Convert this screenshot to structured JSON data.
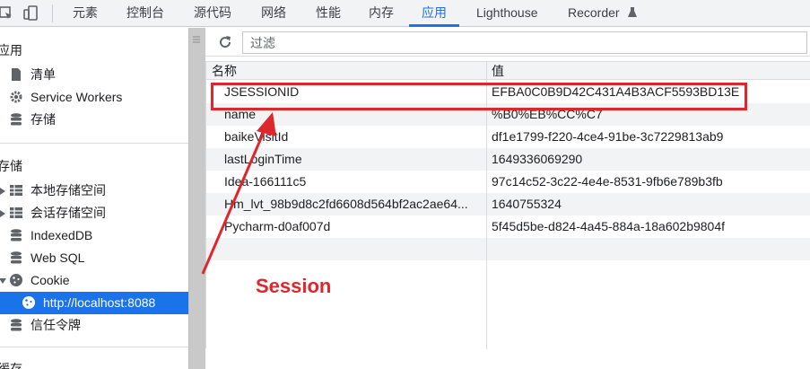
{
  "toolbar": {
    "tabs": [
      {
        "label": "元素"
      },
      {
        "label": "控制台"
      },
      {
        "label": "源代码"
      },
      {
        "label": "网络"
      },
      {
        "label": "性能"
      },
      {
        "label": "内存"
      },
      {
        "label": "应用"
      },
      {
        "label": "Lighthouse"
      },
      {
        "label": "Recorder"
      }
    ],
    "active_tab": "应用",
    "accent": "#1a73e8"
  },
  "sidebar": {
    "section_app": "应用",
    "section_storage": "存储",
    "section_cache": "缓存",
    "app_items": [
      {
        "label": "清单",
        "icon": "file-icon"
      },
      {
        "label": "Service Workers",
        "icon": "gear-icon"
      },
      {
        "label": "存储",
        "icon": "database-icon"
      }
    ],
    "storage_items": [
      {
        "label": "本地存储空间",
        "icon": "grid-icon"
      },
      {
        "label": "会话存储空间",
        "icon": "grid-icon"
      },
      {
        "label": "IndexedDB",
        "icon": "database-icon"
      },
      {
        "label": "Web SQL",
        "icon": "database-icon"
      },
      {
        "label": "Cookie",
        "icon": "cookie-icon"
      },
      {
        "label": "http://localhost:8088",
        "icon": "cookie-icon"
      },
      {
        "label": "信任令牌",
        "icon": "database-icon"
      }
    ]
  },
  "filter": {
    "placeholder": "过滤"
  },
  "table": {
    "headers": [
      "名称",
      "值"
    ],
    "rows": [
      {
        "name": "JSESSIONID",
        "value": "EFBA0C0B9D42C431A4B3ACF5593BD13E"
      },
      {
        "name": "name",
        "value": "%B0%EB%CC%C7"
      },
      {
        "name": "baikeVisitId",
        "value": "df1e1799-f220-4ce4-91be-3c7229813ab9"
      },
      {
        "name": "lastLoginTime",
        "value": "1649336069290"
      },
      {
        "name": "Idea-166111c5",
        "value": "97c14c52-3c22-4e4e-8531-9fb6e789b3fb"
      },
      {
        "name": "Hm_lvt_98b9d8c2fd6608d564bf2ac2ae64...",
        "value": "1640755324"
      },
      {
        "name": "Pycharm-d0af007d",
        "value": "5f45d5be-d824-4a45-884a-18a602b9804f"
      }
    ]
  },
  "annotation": {
    "label": "Session",
    "color": "#e0262d"
  }
}
